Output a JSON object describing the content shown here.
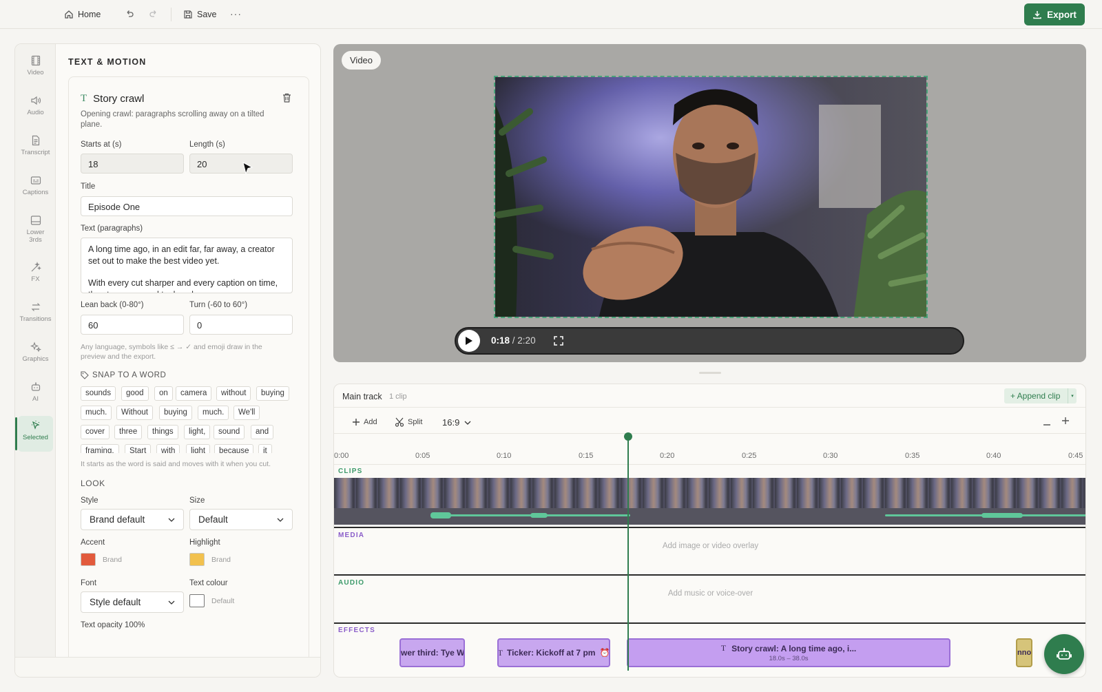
{
  "topbar": {
    "home_label": "Home",
    "save_label": "Save",
    "export_label": "Export"
  },
  "rail": {
    "items": [
      {
        "label": "Video",
        "icon": "film-icon"
      },
      {
        "label": "Audio",
        "icon": "speaker-icon"
      },
      {
        "label": "Transcript",
        "icon": "document-icon"
      },
      {
        "label": "Captions",
        "icon": "captions-icon"
      },
      {
        "label": "Lower 3rds",
        "icon": "lower-thirds-icon"
      },
      {
        "label": "FX",
        "icon": "wand-icon"
      },
      {
        "label": "Transitions",
        "icon": "transitions-icon"
      },
      {
        "label": "Graphics",
        "icon": "sparkle-icon"
      },
      {
        "label": "AI",
        "icon": "robot-icon"
      },
      {
        "label": "Selected",
        "icon": "cursor-icon"
      }
    ]
  },
  "panel": {
    "title": "TEXT & MOTION",
    "card_title": "Story crawl",
    "card_desc": "Opening crawl: paragraphs scrolling away on a tilted plane.",
    "starts_label": "Starts at (s)",
    "starts_value": "18",
    "length_label": "Length (s)",
    "length_value": "20",
    "title_label": "Title",
    "title_value": "Episode One",
    "text_label": "Text (paragraphs)",
    "text_p1": "A long time ago, in an edit far, far away, a creator set out to make the best video yet.",
    "text_p2": "With every cut sharper and every caption on time, the story grew and took a shape.",
    "lean_label": "Lean back (0-80°)",
    "lean_value": "60",
    "turn_label": "Turn (-60 to 60°)",
    "turn_value": "0",
    "symbols_hint": "Any language, symbols like ≤ → ✓ and emoji draw in the preview and the export.",
    "snap_label": "SNAP TO A WORD",
    "words": [
      "sounds",
      "good",
      "on",
      "camera",
      "without",
      "buying",
      "much.",
      "Without",
      "buying",
      "much.",
      "We'll",
      "cover",
      "three",
      "things",
      "light,",
      "sound",
      "and",
      "framing.",
      "Start",
      "with",
      "light",
      "because",
      "it"
    ],
    "snap_hint": "It starts as the word is said and moves with it when you cut.",
    "look_label": "LOOK",
    "style_label": "Style",
    "style_value": "Brand default",
    "size_label": "Size",
    "size_value": "Default",
    "accent_label": "Accent",
    "accent_caption": "Brand",
    "accent_color": "#e25a3c",
    "highlight_label": "Highlight",
    "highlight_caption": "Brand",
    "highlight_color": "#f2c14e",
    "font_label": "Font",
    "font_value": "Style default",
    "textcolour_label": "Text colour",
    "textcolour_caption": "Default",
    "textcolour_color": "#ffffff",
    "opacity_label": "Text opacity 100%"
  },
  "video": {
    "badge": "Video",
    "current_time": "0:18",
    "total_time": "/ 2:20"
  },
  "timeline": {
    "track_name": "Main track",
    "clip_count": "1 clip",
    "append_label": "+ Append clip",
    "add_label": "Add",
    "split_label": "Split",
    "ratio": "16:9",
    "ticks": [
      "0:00",
      "0:05",
      "0:10",
      "0:15",
      "0:20",
      "0:25",
      "0:30",
      "0:35",
      "0:40",
      "0:45"
    ],
    "tracks": {
      "clips": "CLIPS",
      "media": "MEDIA",
      "audio": "AUDIO",
      "effects": "EFFECTS"
    },
    "media_placeholder": "Add image or video overlay",
    "audio_placeholder": "Add music or voice-over",
    "fx": {
      "lower_third": "wer third: Tye W",
      "ticker": "Ticker: Kickoff at 7 pm",
      "crawl": "Story crawl: A long time ago, i...",
      "crawl_range": "18.0s – 38.0s",
      "annot": "nnot"
    }
  }
}
